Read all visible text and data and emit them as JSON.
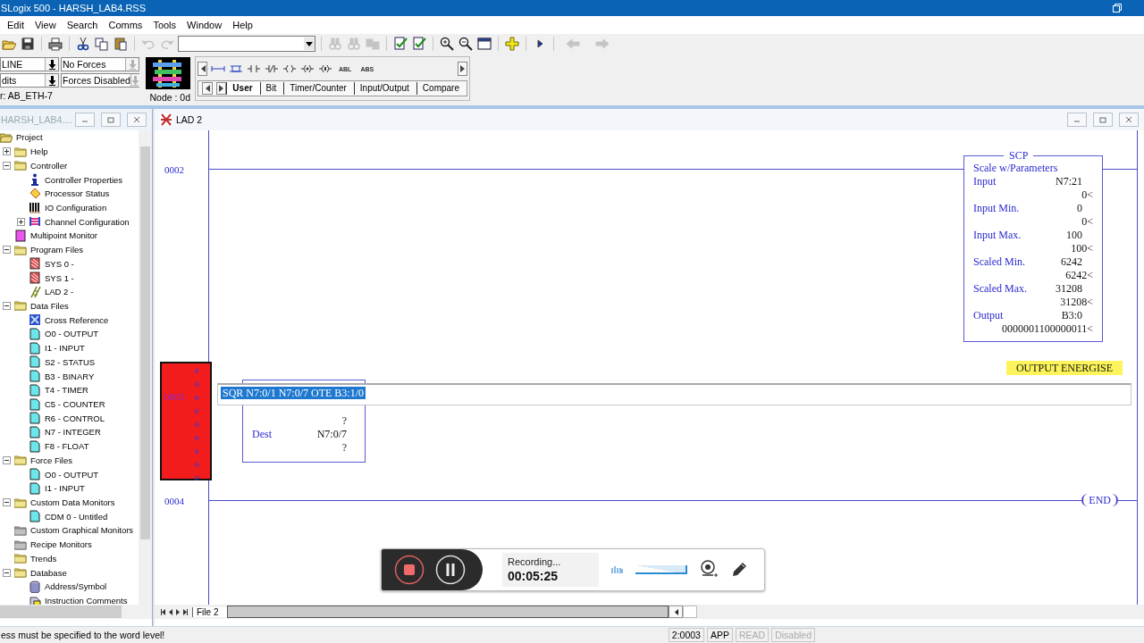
{
  "window": {
    "title": "SLogix 500 - HARSH_LAB4.RSS"
  },
  "menu": [
    "Edit",
    "View",
    "Search",
    "Comms",
    "Tools",
    "Window",
    "Help"
  ],
  "toolbar": [
    {
      "kind": "open",
      "disabled": false
    },
    {
      "kind": "save",
      "disabled": false
    },
    {
      "kind": "sep"
    },
    {
      "kind": "print",
      "disabled": false
    },
    {
      "kind": "sep"
    },
    {
      "kind": "cut",
      "disabled": false
    },
    {
      "kind": "copy",
      "disabled": false
    },
    {
      "kind": "paste",
      "disabled": false
    },
    {
      "kind": "sep"
    },
    {
      "kind": "undo",
      "disabled": true
    },
    {
      "kind": "redo",
      "disabled": true
    },
    {
      "kind": "combo"
    },
    {
      "kind": "sep"
    },
    {
      "kind": "find",
      "disabled": true
    },
    {
      "kind": "find",
      "disabled": true
    },
    {
      "kind": "replace",
      "disabled": true
    },
    {
      "kind": "sep"
    },
    {
      "kind": "verify",
      "disabled": false
    },
    {
      "kind": "verify",
      "disabled": false
    },
    {
      "kind": "sep"
    },
    {
      "kind": "zoom-in",
      "disabled": false
    },
    {
      "kind": "zoom-out",
      "disabled": false
    },
    {
      "kind": "window",
      "disabled": false
    },
    {
      "kind": "sep"
    },
    {
      "kind": "add",
      "disabled": false
    },
    {
      "kind": "sep"
    },
    {
      "kind": "run",
      "disabled": false
    },
    {
      "kind": "sep"
    },
    {
      "kind": "back",
      "disabled": true
    },
    {
      "kind": "forward",
      "disabled": true
    }
  ],
  "mode_panel": {
    "dropdowns": [
      {
        "value": "LINE",
        "disabled": false
      },
      {
        "value": "No Forces",
        "disabled": true
      },
      {
        "value": "dits",
        "disabled": false
      },
      {
        "value": "Forces Disabled",
        "disabled": true
      }
    ],
    "driver": "r: AB_ETH-7",
    "node": "Node : 0d"
  },
  "palette": {
    "labels": [
      "ABL",
      "ABS"
    ],
    "tabs": [
      {
        "label": "User",
        "selected": true
      },
      {
        "label": "Bit",
        "selected": false
      },
      {
        "label": "Timer/Counter",
        "selected": false
      },
      {
        "label": "Input/Output",
        "selected": false
      },
      {
        "label": "Compare",
        "selected": false
      }
    ]
  },
  "project_window": {
    "title": "HARSH_LAB4....",
    "tree": [
      {
        "label": "Project",
        "kind": "folder-open",
        "children": [
          {
            "label": "Help",
            "kind": "folder",
            "expanded": false
          },
          {
            "label": "Controller",
            "kind": "folder",
            "expanded": true,
            "children": [
              {
                "label": "Controller Properties",
                "kind": "info"
              },
              {
                "label": "Processor Status",
                "kind": "processor"
              },
              {
                "label": "IO Configuration",
                "kind": "io"
              },
              {
                "label": "Channel Configuration",
                "kind": "channel",
                "expanded": false
              }
            ]
          },
          {
            "label": "Multipoint Monitor",
            "kind": "monitor"
          },
          {
            "label": "Program Files",
            "kind": "folder",
            "expanded": true,
            "children": [
              {
                "label": "SYS 0 -",
                "kind": "sys"
              },
              {
                "label": "SYS 1 -",
                "kind": "sys"
              },
              {
                "label": "LAD 2 -",
                "kind": "ladder"
              }
            ]
          },
          {
            "label": "Data Files",
            "kind": "folder",
            "expanded": true,
            "children": [
              {
                "label": "Cross Reference",
                "kind": "xref"
              },
              {
                "label": "O0 - OUTPUT",
                "kind": "data"
              },
              {
                "label": "I1 - INPUT",
                "kind": "data"
              },
              {
                "label": "S2 - STATUS",
                "kind": "data"
              },
              {
                "label": "B3 - BINARY",
                "kind": "data"
              },
              {
                "label": "T4 - TIMER",
                "kind": "data"
              },
              {
                "label": "C5 - COUNTER",
                "kind": "data"
              },
              {
                "label": "R6 - CONTROL",
                "kind": "data"
              },
              {
                "label": "N7 - INTEGER",
                "kind": "data"
              },
              {
                "label": "F8 - FLOAT",
                "kind": "data"
              }
            ]
          },
          {
            "label": "Force Files",
            "kind": "folder",
            "expanded": true,
            "children": [
              {
                "label": "O0 - OUTPUT",
                "kind": "data"
              },
              {
                "label": "I1 - INPUT",
                "kind": "data"
              }
            ]
          },
          {
            "label": "Custom Data Monitors",
            "kind": "folder",
            "expanded": true,
            "children": [
              {
                "label": "CDM 0 - Untitled",
                "kind": "data"
              }
            ]
          },
          {
            "label": "Custom Graphical Monitors",
            "kind": "folder-grey"
          },
          {
            "label": "Recipe Monitors",
            "kind": "folder-grey"
          },
          {
            "label": "Trends",
            "kind": "folder"
          },
          {
            "label": "Database",
            "kind": "folder",
            "expanded": true,
            "children": [
              {
                "label": "Address/Symbol",
                "kind": "symbol"
              },
              {
                "label": "Instruction Comments",
                "kind": "comments"
              }
            ]
          }
        ]
      }
    ]
  },
  "ladder_window": {
    "title": "LAD 2",
    "rungs": [
      {
        "number": "0002",
        "kind": "block",
        "editing": false,
        "block": {
          "mnemonic": "SCP",
          "title": "Scale w/Parameters",
          "rows": [
            {
              "label": "Input",
              "value": "N7:21"
            },
            {
              "value": "0<"
            },
            {
              "label": "Input Min.",
              "value": "0"
            },
            {
              "value": "0<"
            },
            {
              "label": "Input Max.",
              "value": "100"
            },
            {
              "value": "100<"
            },
            {
              "label": "Scaled Min.",
              "value": "6242"
            },
            {
              "value": "6242<"
            },
            {
              "label": "Scaled Max.",
              "value": "31208"
            },
            {
              "value": "31208<"
            },
            {
              "label": "Output",
              "value": "B3:0"
            },
            {
              "value": "0000001100000011<"
            }
          ]
        }
      },
      {
        "number": "0003",
        "kind": "edit",
        "editing": true,
        "edit_marks": [
          "e",
          "e",
          "e",
          "e",
          "e",
          "e",
          "e",
          "e",
          "e"
        ],
        "block": {
          "rows": [
            {
              "value": "?"
            },
            {
              "label": "Dest",
              "value": "N7:0/7"
            },
            {
              "value": "?"
            }
          ]
        },
        "output_comment": "OUTPUT ENERGISE",
        "edit_text": "SQR N7:0/1 N7:0/7 OTE B3:1/0"
      },
      {
        "number": "0004",
        "kind": "end",
        "editing": false,
        "end_label": "END"
      }
    ],
    "file_tabs": [
      {
        "label": "File 2",
        "selected": true
      }
    ]
  },
  "recorder": {
    "status": "Recording...",
    "time": "00:05:25",
    "volume": {
      "level": 1.0
    }
  },
  "status_bar": {
    "message": "ess must be specified to the word level!",
    "fields": [
      {
        "text": "2:0003",
        "disabled": false
      },
      {
        "text": "APP",
        "disabled": false
      },
      {
        "text": "READ",
        "disabled": true
      },
      {
        "text": "Disabled",
        "disabled": true
      }
    ]
  }
}
